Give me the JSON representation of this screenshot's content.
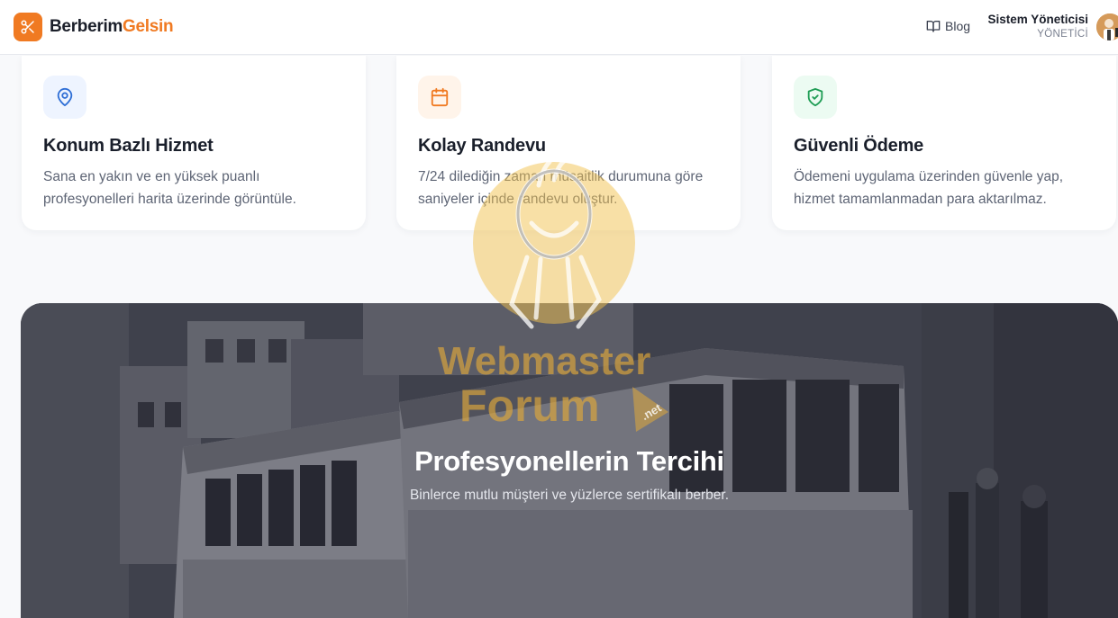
{
  "header": {
    "brand_part1": "Berberim",
    "brand_part2": "Gelsin",
    "blog_label": "Blog",
    "user_name": "Sistem Yöneticisi",
    "user_role": "YÖNETİCİ"
  },
  "features": [
    {
      "title": "Konum Bazlı Hizmet",
      "description": "Sana en yakın ve en yüksek puanlı profesyonelleri harita üzerinde görüntüle.",
      "icon": "map-pin-icon",
      "icon_color": "#2f6fd6",
      "icon_bg": "#eef4ff"
    },
    {
      "title": "Kolay Randevu",
      "description": "7/24 dilediğin zaman müsaitlik durumuna göre saniyeler içinde randevu oluştur.",
      "icon": "calendar-icon",
      "icon_color": "#f07a22",
      "icon_bg": "#fff4ea"
    },
    {
      "title": "Güvenli Ödeme",
      "description": "Ödemeni uygulama üzerinden güvenle yap, hizmet tamamlanmadan para aktarılmaz.",
      "icon": "shield-check-icon",
      "icon_color": "#1f9d55",
      "icon_bg": "#ecfbf2"
    }
  ],
  "hero": {
    "title": "Profesyonellerin Tercihi",
    "subtitle": "Binlerce mutlu müşteri ve yüzlerce sertifikalı berber."
  },
  "watermark": {
    "line1": "Webmaster",
    "line2": "Forum",
    "badge": ".net"
  },
  "colors": {
    "accent": "#f07a22",
    "watermark": "#f2c14e"
  }
}
